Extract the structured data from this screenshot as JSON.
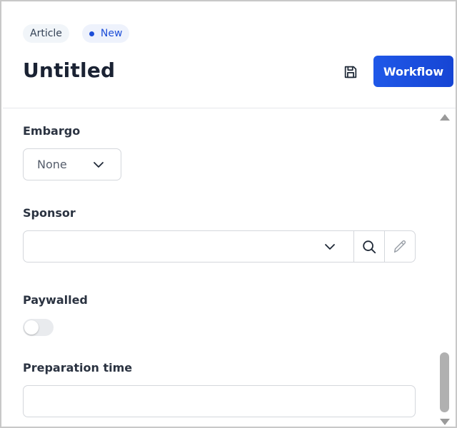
{
  "header": {
    "type_badge": "Article",
    "status_badge": "New",
    "title": "Untitled",
    "workflow_label": "Workflow"
  },
  "fields": {
    "embargo": {
      "label": "Embargo",
      "value": "None"
    },
    "sponsor": {
      "label": "Sponsor",
      "value": ""
    },
    "paywalled": {
      "label": "Paywalled",
      "on": false
    },
    "preparation_time": {
      "label": "Preparation time",
      "value": ""
    }
  },
  "icons": {
    "save": "floppy-disk-icon",
    "search": "magnifier-icon",
    "edit": "pencil-icon",
    "dropdown": "chevron-down-icon"
  },
  "colors": {
    "accent": "#1f58e8",
    "status_dot": "#1d4ed8"
  }
}
